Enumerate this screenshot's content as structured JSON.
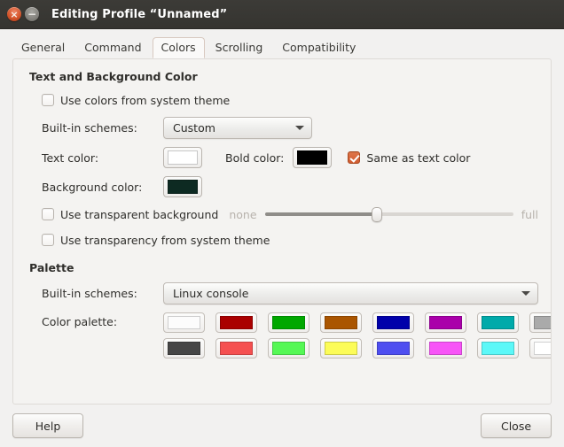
{
  "window": {
    "title": "Editing Profile “Unnamed”",
    "close_glyph": "×",
    "minimize_glyph": "−"
  },
  "tabs": [
    {
      "label": "General",
      "active": false
    },
    {
      "label": "Command",
      "active": false
    },
    {
      "label": "Colors",
      "active": true
    },
    {
      "label": "Scrolling",
      "active": false
    },
    {
      "label": "Compatibility",
      "active": false
    }
  ],
  "text_bg_section": {
    "title": "Text and Background Color",
    "use_system_theme": {
      "label": "Use colors from system theme",
      "checked": false
    },
    "builtin_schemes": {
      "label": "Built-in schemes:",
      "value": "Custom"
    },
    "text_color": {
      "label": "Text color:",
      "value": "#ffffff"
    },
    "bold_color": {
      "label": "Bold color:",
      "value": "#000000"
    },
    "same_as_text": {
      "label": "Same as text color",
      "checked": true
    },
    "background_color": {
      "label": "Background color:",
      "value": "#0d2a22"
    },
    "transparent_background": {
      "label": "Use transparent background",
      "checked": false
    },
    "slider": {
      "min_label": "none",
      "max_label": "full",
      "value_percent": 45
    },
    "transparency_system_theme": {
      "label": "Use transparency from system theme",
      "checked": false
    }
  },
  "palette_section": {
    "title": "Palette",
    "builtin_schemes": {
      "label": "Built-in schemes:",
      "value": "Linux console"
    },
    "color_palette_label": "Color palette:",
    "rows": [
      [
        "#fcfcfc",
        "#aa0000",
        "#00a800",
        "#aa5500",
        "#0000aa",
        "#aa00aa",
        "#00aaaa",
        "#aaaaaa"
      ],
      [
        "#464646",
        "#f55050",
        "#55f855",
        "#fcfc58",
        "#4e4ef0",
        "#f754f7",
        "#5cf8f8",
        "#ffffff"
      ]
    ]
  },
  "buttons": {
    "help": "Help",
    "close": "Close"
  }
}
